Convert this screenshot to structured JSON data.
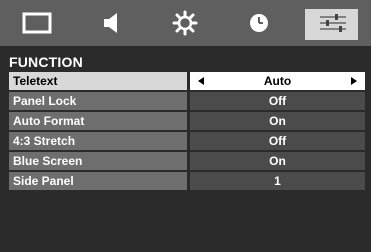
{
  "tabs": [
    {
      "icon": "picture-icon",
      "selected": false
    },
    {
      "icon": "speaker-icon",
      "selected": false
    },
    {
      "icon": "gear-icon",
      "selected": false
    },
    {
      "icon": "clock-icon",
      "selected": false
    },
    {
      "icon": "sliders-icon",
      "selected": true
    }
  ],
  "menu": {
    "title": "FUNCTION",
    "items": [
      {
        "label": "Teletext",
        "value": "Auto"
      },
      {
        "label": "Panel Lock",
        "value": "Off"
      },
      {
        "label": "Auto Format",
        "value": "On"
      },
      {
        "label": "4:3 Stretch",
        "value": "Off"
      },
      {
        "label": "Blue Screen",
        "value": "On"
      },
      {
        "label": "Side Panel",
        "value": "1"
      }
    ]
  },
  "colors": {
    "background": "#2b2b2b",
    "tab_bar": "#5f5f5f",
    "tab_selected": "#d7d7d7",
    "label_bg": "#6e6e6e",
    "value_bg": "#4b4b4b",
    "active_value_bg": "#ffffff"
  }
}
